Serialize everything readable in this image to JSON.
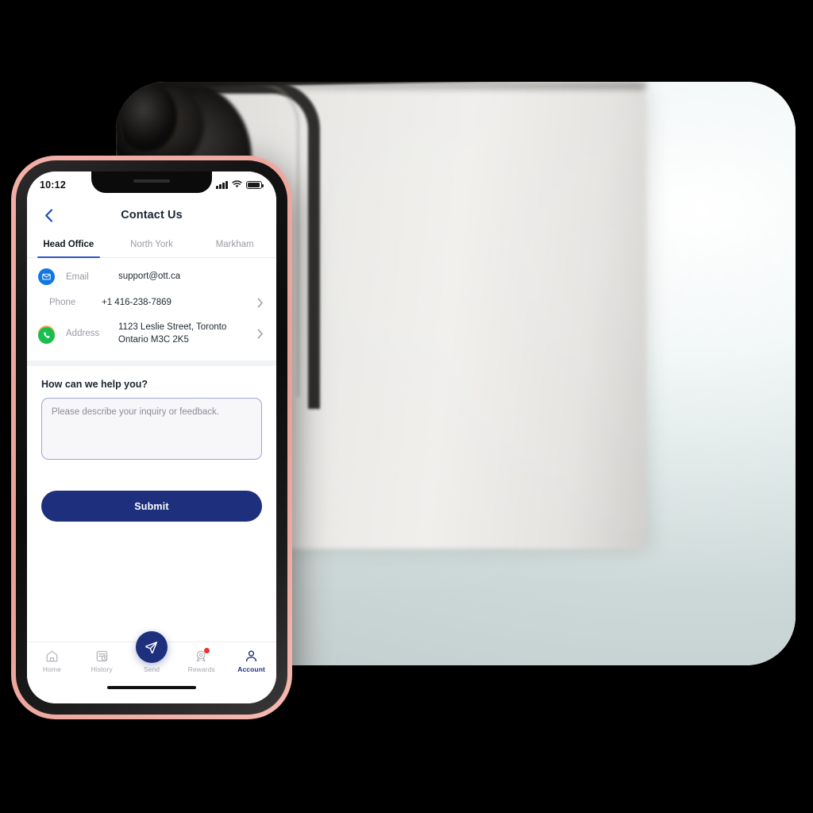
{
  "background_photo": {
    "description": "blurred black over-ear headset with boom microphone resting on a laptop screen in a bright office",
    "corner_radius_px": 62
  },
  "phone": {
    "bezel_color": "#f0a89f",
    "frame_color": "#141314",
    "status_bar": {
      "time": "10:12",
      "icons": [
        "signal-bars-icon",
        "wifi-icon",
        "battery-icon"
      ]
    },
    "nav": {
      "back_icon": "chevron-left-icon",
      "title": "Contact Us"
    },
    "tabs": {
      "active_index": 0,
      "accent_color": "#2a52c6",
      "items": [
        {
          "label": "Head Office"
        },
        {
          "label": "North York"
        },
        {
          "label": "Markham"
        }
      ]
    },
    "contacts": [
      {
        "icon": "envelope-icon",
        "icon_color": "#1177e3",
        "label": "Email",
        "value": "support@ott.ca",
        "has_chevron": false
      },
      {
        "icon": "phone-icon",
        "icon_color": "#18be4e",
        "label": "Phone",
        "value": "+1 416-238-7869",
        "has_chevron": true
      },
      {
        "icon": "map-pin-icon",
        "icon_color": "#eead52",
        "label": "Address",
        "value": "1123 Leslie Street, Toronto\nOntario M3C 2K5",
        "has_chevron": true
      }
    ],
    "help": {
      "title": "How can we help you?",
      "message_value": "",
      "message_placeholder": "Please describe your inquiry or feedback.",
      "submit_label": "Submit",
      "submit_color": "#1e2f7d"
    },
    "tabbar": {
      "active_index": 4,
      "active_color": "#1e2f7d",
      "items": [
        {
          "label": "Home",
          "icon": "home-icon",
          "badge": false
        },
        {
          "label": "History",
          "icon": "history-icon",
          "badge": false
        },
        {
          "label": "Send",
          "icon": "send-icon",
          "badge": false
        },
        {
          "label": "Rewards",
          "icon": "medal-icon",
          "badge": true
        },
        {
          "label": "Account",
          "icon": "person-icon",
          "badge": false
        }
      ],
      "fab": {
        "icon": "send-icon",
        "color": "#1e2f7d"
      },
      "badge_color": "#f0312b"
    },
    "home_indicator": true
  }
}
